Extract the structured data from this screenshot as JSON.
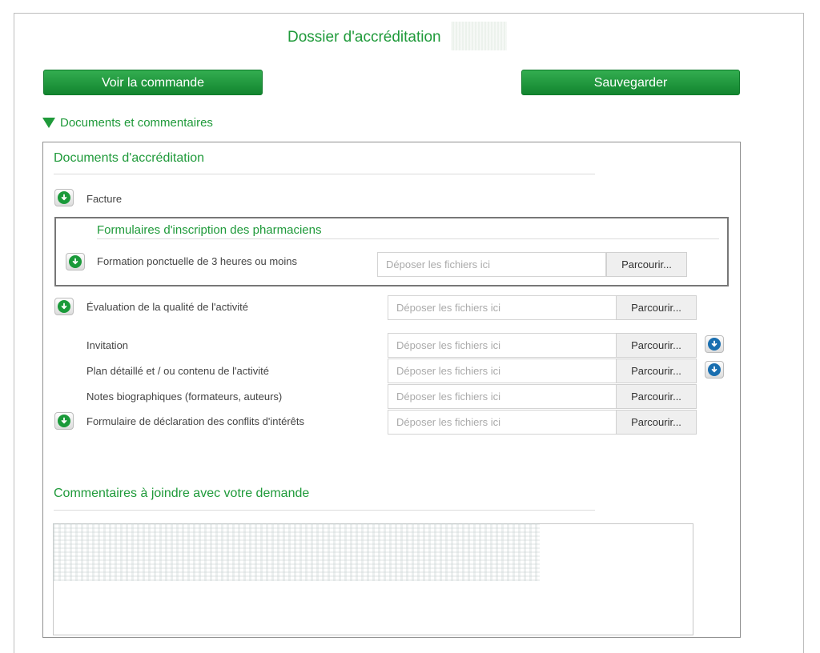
{
  "page": {
    "title": "Dossier d'accréditation",
    "buttons": {
      "view_order": "Voir la commande",
      "save": "Sauvegarder"
    }
  },
  "section": {
    "toggle_label": "Documents et commentaires",
    "documents_heading": "Documents d'accréditation",
    "comments_heading": "Commentaires à joindre avec votre demande"
  },
  "rows": {
    "invoice": "Facture",
    "pharmacist_forms_heading": "Formulaires d'inscription des pharmaciens",
    "training": "Formation ponctuelle de 3 heures ou moins",
    "evaluation": "Évaluation de la qualité de l'activité",
    "invitation": "Invitation",
    "plan": "Plan détaillé et / ou contenu de l'activité",
    "bio_notes": "Notes biographiques (formateurs, auteurs)",
    "conflicts": "Formulaire de déclaration des conflits d'intérêts"
  },
  "upload": {
    "dropzone_text": "Déposer les fichiers ici",
    "browse_label": "Parcourir..."
  },
  "colors": {
    "accent": "#1f9a3a",
    "download_blue": "#1a6fb0"
  },
  "icons": {
    "download": "download-arrow-icon",
    "expand": "triangle-down-icon"
  }
}
